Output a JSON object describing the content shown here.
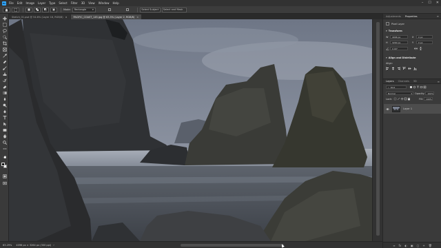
{
  "menubar": {
    "items": [
      "File",
      "Edit",
      "Image",
      "Layer",
      "Type",
      "Select",
      "Filter",
      "3D",
      "View",
      "Window",
      "Help"
    ],
    "window_controls": [
      "–",
      "☐",
      "✕"
    ]
  },
  "options_bar": {
    "mode_label": "Mode:",
    "mode_value": "Rectangle",
    "select_subject": "Select Subject",
    "select_and_mask": "Select and Mask..."
  },
  "tabs": [
    {
      "label": "Sketch_01.psd @ 54.6% (Layer 18, RGB/8)",
      "active": false,
      "close": "×"
    },
    {
      "label": "PACIFIC_COAST_145.jpg @ 63.5% (Layer 2, RGB/8)",
      "active": true,
      "close": "×"
    }
  ],
  "status": {
    "zoom": "63.29%",
    "doc_info": "4096 px × 3264 px (300 ppi)",
    "arrow": "›"
  },
  "panel": {
    "tabs": [
      "Adjustments",
      "Properties"
    ],
    "pixel_layer": "Pixel Layer",
    "transform_title": "Transform",
    "w_label": "W",
    "w_value": "4096 px",
    "h_label": "H",
    "h_value": "3264 px",
    "x_label": "X",
    "x_value": "0 px",
    "y_label": "Y",
    "y_value": "0 px",
    "angle_value": "0.00°",
    "align_title": "Align and Distribute",
    "align_label": "Align:"
  },
  "layers": {
    "tabs": [
      "Layers",
      "Channels",
      "3D"
    ],
    "kind_label": "Kind",
    "blend_mode": "Normal",
    "opacity_label": "Opacity:",
    "opacity_value": "100%",
    "lock_label": "Lock:",
    "fill_label": "Fill:",
    "fill_value": "100%",
    "layer_name": "Layer 1",
    "footer_icons": [
      "∞",
      "fx",
      "◐",
      "▣",
      "▢",
      "+",
      "🗑"
    ]
  },
  "colors": {
    "accent": "#31a8ff",
    "sky": "#7b8291",
    "rock": "#2a2b2d"
  },
  "icons": {
    "tools": [
      "move-icon",
      "marquee-icon",
      "lasso-icon",
      "quick-select-icon",
      "crop-icon",
      "frame-icon",
      "eyedropper-icon",
      "healing-icon",
      "brush-icon",
      "clone-stamp-icon",
      "history-brush-icon",
      "eraser-icon",
      "gradient-icon",
      "blur-icon",
      "dodge-icon",
      "pen-icon",
      "type-icon",
      "path-select-icon",
      "shape-icon",
      "hand-icon",
      "zoom-icon",
      "more-tools-icon"
    ]
  }
}
